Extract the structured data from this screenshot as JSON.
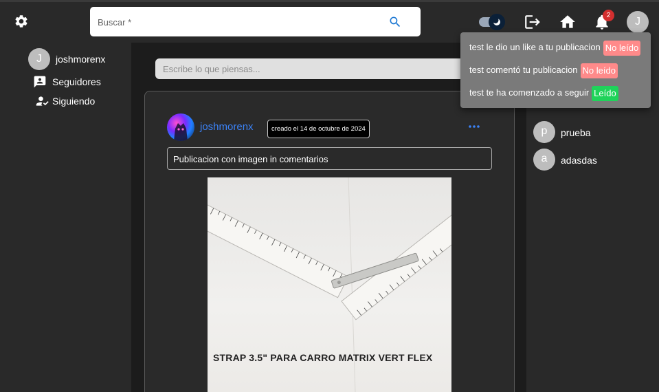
{
  "header": {
    "search": {
      "placeholder": "Buscar *",
      "value": ""
    },
    "notification_count": "2",
    "avatar_initial": "J",
    "theme_mode": "dark"
  },
  "sidebar": {
    "user": {
      "initial": "J",
      "name": "joshmorenx"
    },
    "items": [
      {
        "label": "Seguidores",
        "icon": "followers-icon"
      },
      {
        "label": "Siguiendo",
        "icon": "following-icon"
      }
    ]
  },
  "composer": {
    "placeholder": "Escribe lo que piensas..."
  },
  "post": {
    "author": "joshmorenx",
    "date": "creado el 14 de octubre de 2024",
    "text": "Publicacion con imagen in comentarios",
    "image_caption": "STRAP 3.5\" PARA CARRO MATRIX VERT FLEX"
  },
  "suggested_users": [
    {
      "initial": "p",
      "name": "prueba"
    },
    {
      "initial": "a",
      "name": "adasdas"
    }
  ],
  "notifications": [
    {
      "text": "test le dio un like a tu publicacion",
      "status": "No leído",
      "read": false
    },
    {
      "text": "test comentó tu publicacion",
      "status": "No leído",
      "read": false
    },
    {
      "text": "test te ha comenzado a seguir",
      "status": "Leído",
      "read": true
    }
  ],
  "colors": {
    "background": "#292929",
    "accent": "#3b82f6",
    "unread": "#ff8a8a",
    "read": "#1fd35a",
    "badge": "#d32f2f"
  }
}
